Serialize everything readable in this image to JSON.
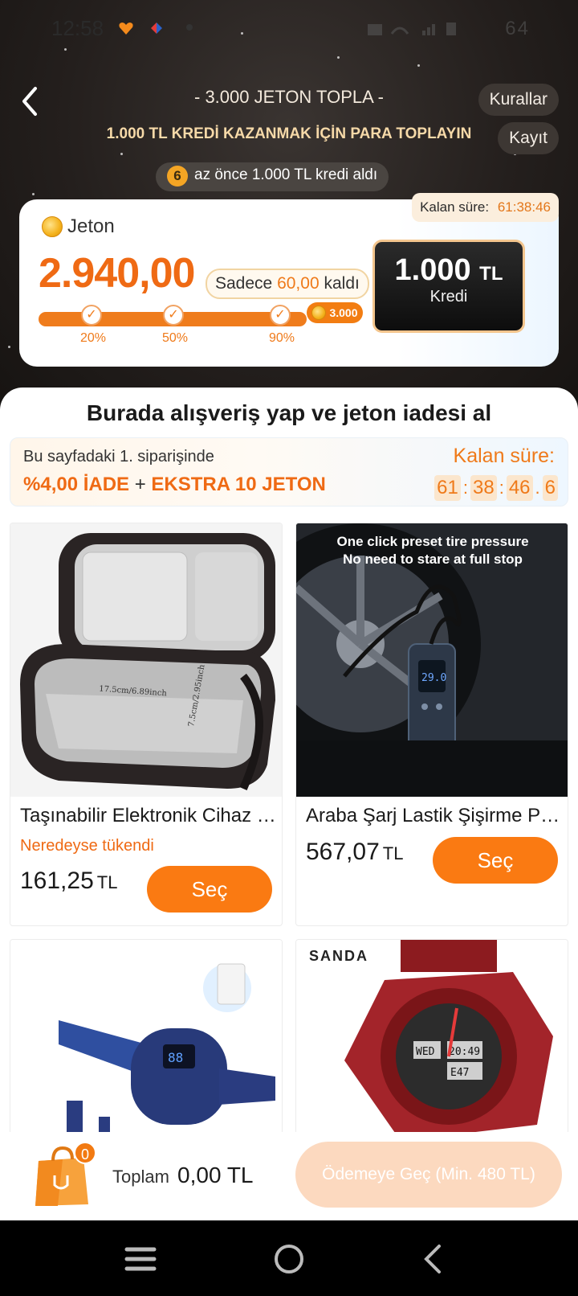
{
  "status_bar": {
    "time": "12:58",
    "right_text": "64"
  },
  "header": {
    "title": "- 3.000 JETON TOPLA -",
    "subtitle": "1.000 TL KREDİ KAZANMAK İÇİN PARA TOPLAYIN",
    "rules_label": "Kurallar",
    "record_label": "Kayıt"
  },
  "recent_activity": {
    "number": "6",
    "text": "az önce 1.000 TL kredi aldı"
  },
  "jeton_card": {
    "remaining_label": "Kalan süre:",
    "remaining_time": "61:38:46",
    "jeton_label": "Jeton",
    "amount": "2.940,00",
    "only_prefix": "Sadece",
    "only_value": "60,00",
    "only_suffix": "kaldı",
    "goal": "3.000",
    "progress": 0.98,
    "milestones": [
      "20%",
      "50%",
      "90%"
    ],
    "credit_amount": "1.000",
    "credit_currency": "TL",
    "credit_label": "Kredi"
  },
  "section_title": "Burada alışveriş yap ve jeton iadesi al",
  "offer": {
    "line1": "Bu sayfadaki 1. siparişinde",
    "refund": "%4,00 İADE",
    "plus": "+",
    "extra": "EKSTRA 10 JETON",
    "timer_label": "Kalan süre:",
    "timer": {
      "h": "61",
      "m": "38",
      "s": "46",
      "ms": "6"
    }
  },
  "products": [
    {
      "name": "Taşınabilir Elektronik Cihaz Çantası",
      "status": "Neredeyse tükendi",
      "price": "161,25",
      "currency": "TL",
      "button": "Seç",
      "img_text": [
        "17.5cm/6.89inch",
        "7.5cm/2.95inch"
      ]
    },
    {
      "name": "Araba Şarj Lastik Şişirme Pompası",
      "status": "",
      "price": "567,07",
      "currency": "TL",
      "button": "Seç",
      "img_text": [
        "One click preset tire pressure",
        "No need to stare at full stop",
        "29.0"
      ]
    },
    {
      "name": "",
      "img_text": [
        "88"
      ]
    },
    {
      "name": "",
      "img_text": [
        "SANDA",
        "WED",
        "20:49",
        "E47"
      ]
    }
  ],
  "cart": {
    "count": "0",
    "total_label": "Toplam",
    "total_value": "0,00 TL",
    "checkout_label": "Ödemeye Geç (Min. 480 TL)"
  },
  "colors": {
    "accent": "#fa7a12",
    "dark_bg": "#241f1d",
    "gold": "#f6d9a8"
  }
}
